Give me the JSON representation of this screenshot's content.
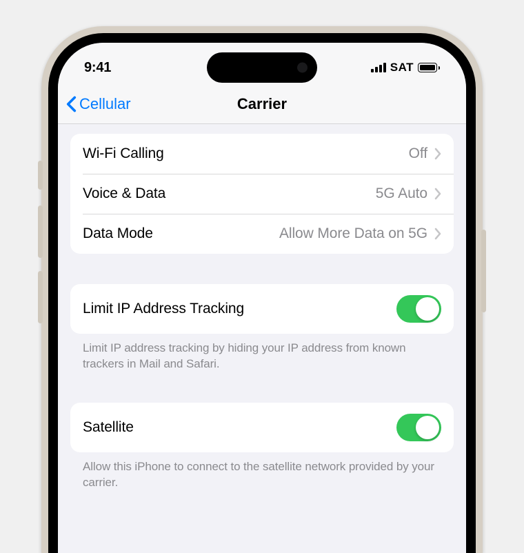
{
  "status": {
    "time": "9:41",
    "network_label": "SAT"
  },
  "nav": {
    "back_label": "Cellular",
    "title": "Carrier"
  },
  "rows": {
    "wifi_calling": {
      "label": "Wi-Fi Calling",
      "value": "Off"
    },
    "voice_data": {
      "label": "Voice & Data",
      "value": "5G Auto"
    },
    "data_mode": {
      "label": "Data Mode",
      "value": "Allow More Data on 5G"
    },
    "limit_ip": {
      "label": "Limit IP Address Tracking",
      "on": true
    },
    "satellite": {
      "label": "Satellite",
      "on": true
    }
  },
  "footers": {
    "limit_ip": "Limit IP address tracking by hiding your IP address from known trackers in Mail and Safari.",
    "satellite": "Allow this iPhone to connect to the satellite network provided by your carrier."
  }
}
